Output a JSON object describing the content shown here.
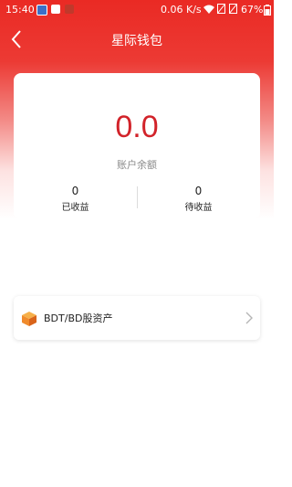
{
  "status_bar": {
    "time": "15:40",
    "network_speed": "0.06 K/s",
    "battery": "67%"
  },
  "nav": {
    "title": "星际钱包",
    "back_icon": "chevron-left-icon"
  },
  "wallet": {
    "balance": "0.0",
    "balance_label": "账户余额",
    "earned_value": "0",
    "earned_label": "已收益",
    "pending_value": "0",
    "pending_label": "待收益"
  },
  "assets": [
    {
      "label": "BDT/BD股资产",
      "icon": "cube-icon"
    }
  ],
  "colors": {
    "header_red": "#ea2a24",
    "balance_red": "#d2232a",
    "icon_orange": "#f08b2c"
  }
}
